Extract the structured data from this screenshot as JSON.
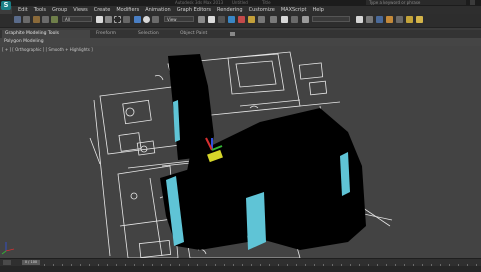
{
  "app": {
    "logo_letter": "S",
    "title_segments": [
      "Autodesk 3ds Max 2013",
      "Untitled",
      "Title"
    ],
    "search_placeholder": "Type a keyword or phrase"
  },
  "menu": [
    "Edit",
    "Tools",
    "Group",
    "Views",
    "Create",
    "Modifiers",
    "Animation",
    "Graph Editors",
    "Rendering",
    "Customize",
    "MAXScript",
    "Help"
  ],
  "toolbar": {
    "selection_filter": "All",
    "reference_coord": "View",
    "named_selection": ""
  },
  "ribbon": {
    "tabs": [
      "Graphite Modeling Tools",
      "Freeform",
      "Selection",
      "Object Paint"
    ],
    "active_panel": "Polygon Modeling"
  },
  "viewport": {
    "label": "[ + ] [ Orthographic ] [ Smooth + Highlights ]",
    "colors": {
      "background": "#434343",
      "lines": "#e8e8e8",
      "solid": "#000000",
      "glass": "#5fc4d6",
      "highlight": "#d6d62a",
      "gizmo_x": "#d63030",
      "gizmo_y": "#34b534",
      "gizmo_z": "#3050e0"
    }
  },
  "timeline": {
    "slider_text": "0 / 100"
  }
}
